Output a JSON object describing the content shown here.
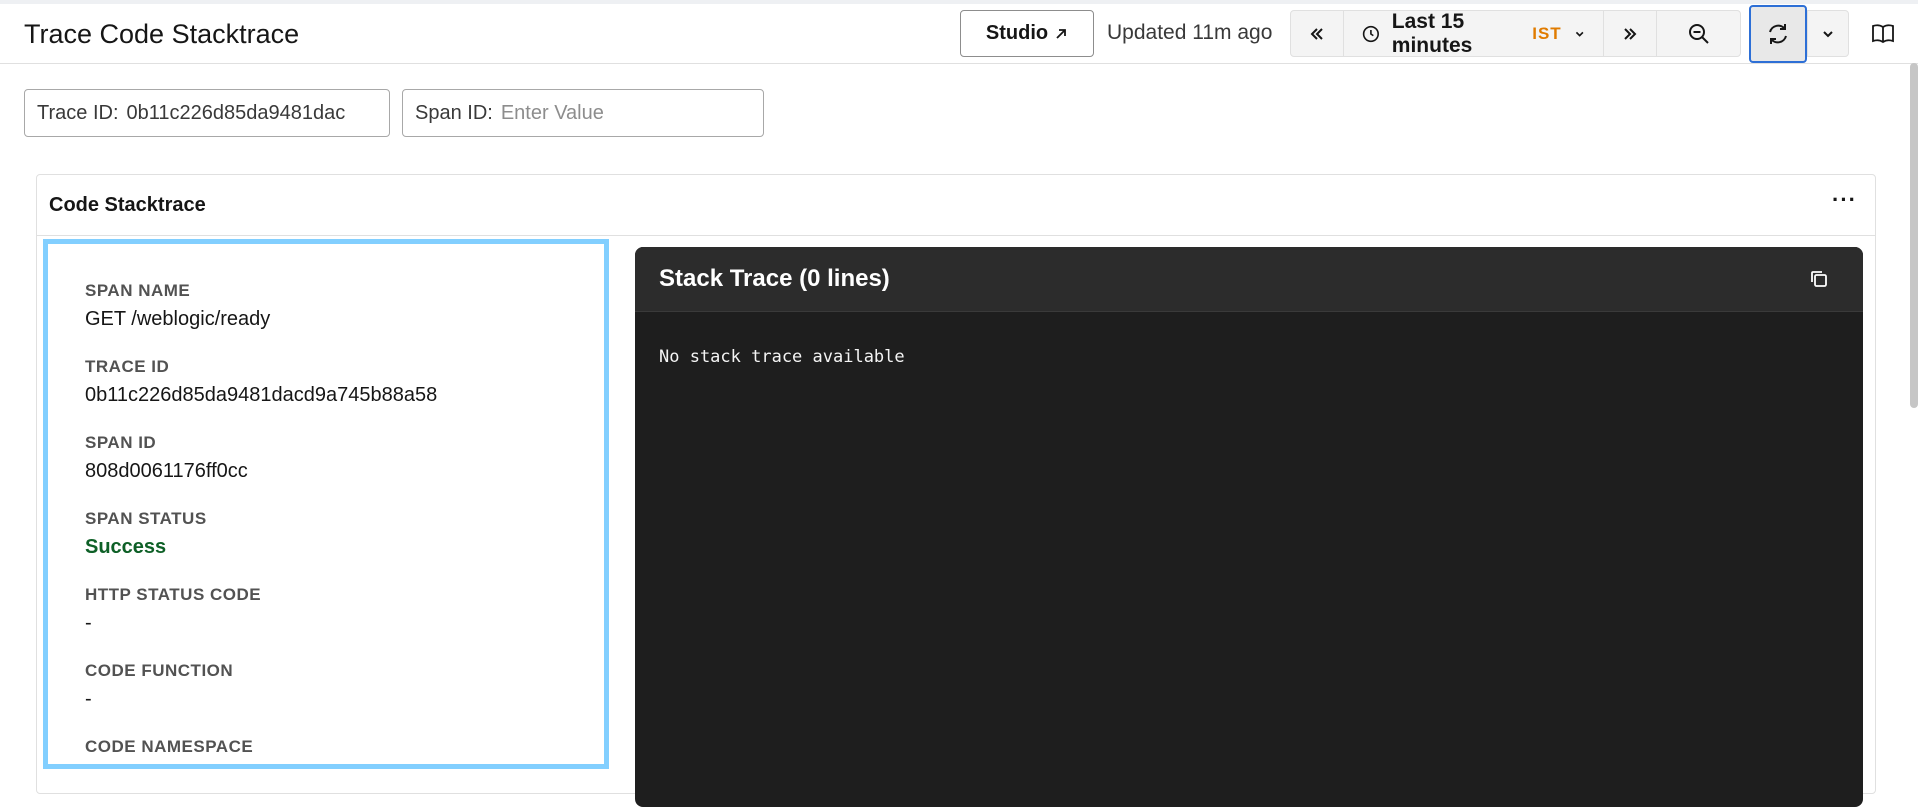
{
  "header": {
    "title": "Trace Code Stacktrace",
    "studio_label": "Studio",
    "updated_text": "Updated 11m ago",
    "time_range": "Last 15 minutes",
    "timezone": "IST"
  },
  "filters": {
    "trace_id": {
      "label": "Trace ID:",
      "value": "0b11c226d85da9481dac"
    },
    "span_id": {
      "label": "Span ID:",
      "placeholder": "Enter Value"
    }
  },
  "panel": {
    "title": "Code Stacktrace",
    "menu": "···",
    "details": [
      {
        "label": "SPAN NAME",
        "value": "GET /weblogic/ready"
      },
      {
        "label": "TRACE ID",
        "value": "0b11c226d85da9481dacd9a745b88a58"
      },
      {
        "label": "SPAN ID",
        "value": "808d0061176ff0cc"
      },
      {
        "label": "SPAN STATUS",
        "value": "Success"
      },
      {
        "label": "HTTP STATUS CODE",
        "value": "-"
      },
      {
        "label": "CODE FUNCTION",
        "value": "-"
      },
      {
        "label": "CODE NAMESPACE",
        "value": "-"
      }
    ],
    "stack": {
      "title": "Stack Trace (0 lines)",
      "body": "No stack trace available"
    }
  },
  "colors": {
    "success": "#0e6027",
    "timezone": "#e07b00",
    "focus": "#2d6fd6",
    "selection": "#82cfff"
  }
}
